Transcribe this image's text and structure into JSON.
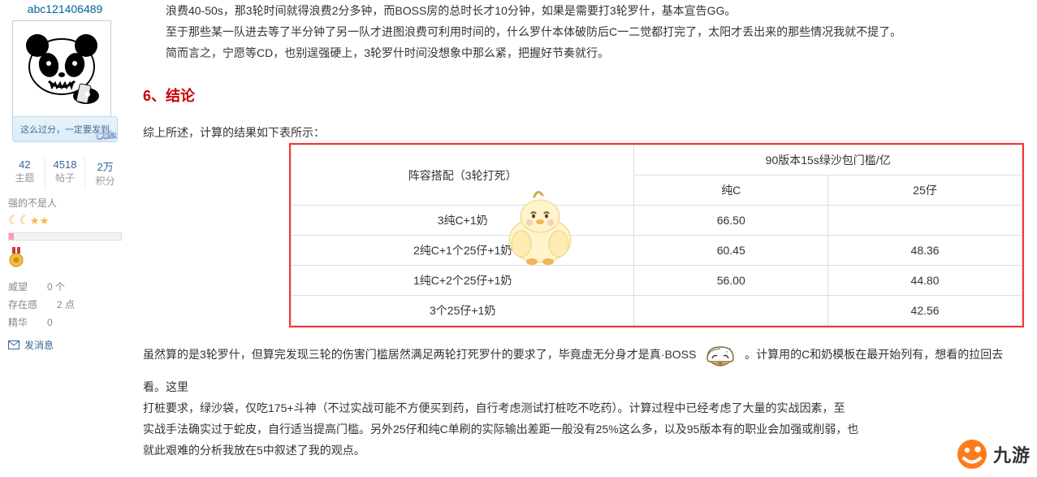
{
  "sidebar": {
    "username": "abc121406489",
    "avatar_banner": "这么过分，一定要发到",
    "stats": [
      {
        "num": "42",
        "label": "主题"
      },
      {
        "num": "4518",
        "label": "帖子"
      },
      {
        "num": "2万",
        "label": "积分"
      }
    ],
    "rank": "强的不是人",
    "meta": {
      "prestige_label": "威望",
      "prestige_val": "0 个",
      "presence_label": "存在感",
      "presence_val": "2 点",
      "essence_label": "精华",
      "essence_val": "0"
    },
    "sendmsg": "发消息"
  },
  "content": {
    "para1": "浪费40-50s，那3轮时间就得浪费2分多钟，而BOSS房的总时长才10分钟，如果是需要打3轮罗什，基本宣告GG。",
    "para2": "至于那些某一队进去等了半分钟了另一队才进图浪费可利用时间的，什么罗什本体破防后C一二觉都打完了，太阳才丢出来的那些情况我就不提了。",
    "para3": "简而言之，宁愿等CD，也别逞强硬上，3轮罗什时间没想象中那么紧，把握好节奏就行。",
    "heading6": "6、结论",
    "intro": "综上所述，计算的结果如下表所示：",
    "body1_a": "虽然算的是3轮罗什，但算完发现三轮的伤害门槛居然满足两轮打死罗什的要求了，毕竟虚无分身才是真·BOSS",
    "body1_b": "。计算用的C和奶模板在最开始列有，想看的拉回去看。这里",
    "body2": "打桩要求，绿沙袋，仅吃175+斗神（不过实战可能不方便买到药，自行考虑测试打桩吃不吃药）。计算过程中已经考虑了大量的实战因素，至",
    "body3": "实战手法确实过于蛇皮，自行适当提高门槛。另外25仔和纯C单刷的实际输出差距一般没有25%这么多，以及95版本有的职业会加强或削弱，也",
    "body4": "就此艰难的分析我放在5中叙述了我的观点。"
  },
  "chart_data": {
    "type": "table",
    "col_header_rowspan": "阵容搭配（3轮打死）",
    "col_header_group": "90版本15s绿沙包门槛/亿",
    "sub_headers": [
      "纯C",
      "25仔"
    ],
    "rows": [
      {
        "lineup": "3纯C+1奶",
        "pureC": "66.50",
        "z25": ""
      },
      {
        "lineup": "2纯C+1个25仔+1奶",
        "pureC": "60.45",
        "z25": "48.36"
      },
      {
        "lineup": "1纯C+2个25仔+1奶",
        "pureC": "56.00",
        "z25": "44.80"
      },
      {
        "lineup": "3个25仔+1奶",
        "pureC": "",
        "z25": "42.56"
      }
    ]
  },
  "watermark": {
    "brand": "九游"
  }
}
